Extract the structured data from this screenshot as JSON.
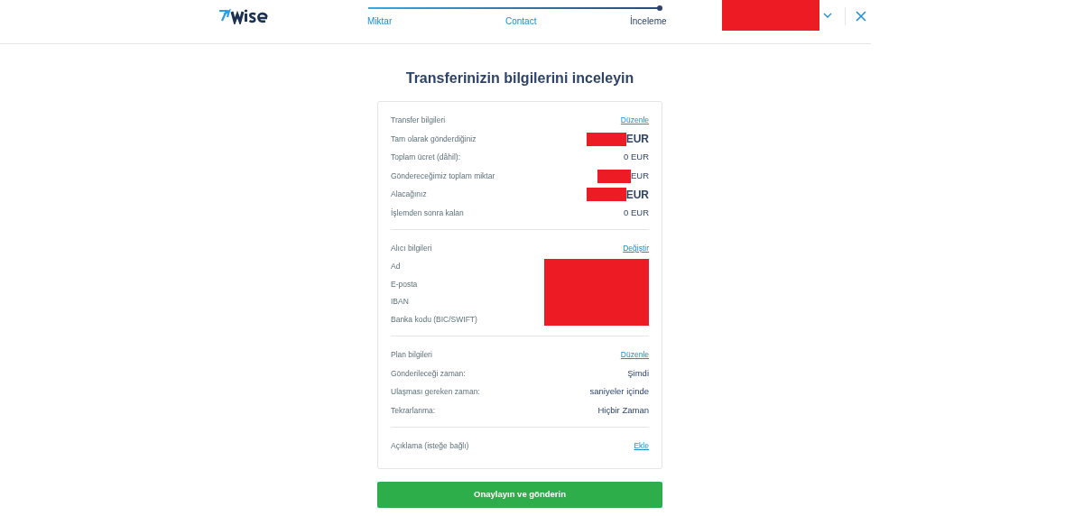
{
  "header": {
    "steps": [
      {
        "label": "Miktar",
        "selected": false
      },
      {
        "label": "Contact",
        "selected": false
      },
      {
        "label": "İnceleme",
        "selected": true
      }
    ],
    "account": {
      "redacted": true
    }
  },
  "title": "Transferinizin bilgilerini inceleyin",
  "sections": [
    {
      "heading": "Transfer bilgileri",
      "action": "Düzenle",
      "rows": [
        {
          "label": "Tam olarak gönderdiğiniz",
          "value": "EUR",
          "redacted": true,
          "emphasis": true
        },
        {
          "label": "Toplam ücret (dâhil):",
          "value": "0 EUR",
          "redacted": false,
          "emphasis": false
        },
        {
          "label": "Göndereceğimiz toplam miktar",
          "value": "EUR",
          "redacted": true,
          "emphasis": false
        },
        {
          "label": "Alacağınız",
          "value": "EUR",
          "redacted": true,
          "emphasis": true
        },
        {
          "label": "İşlemden sonra kalan",
          "value": "0 EUR",
          "redacted": false,
          "emphasis": false
        }
      ]
    },
    {
      "heading": "Alıcı bilgileri",
      "action": "Değiştir",
      "redacted_block": true,
      "rows": [
        {
          "label": "Ad"
        },
        {
          "label": "E-posta"
        },
        {
          "label": "IBAN"
        },
        {
          "label": "Banka kodu (BIC/SWIFT)"
        }
      ]
    },
    {
      "heading": "Plan bilgileri",
      "action": "Düzenle",
      "rows": [
        {
          "label": "Gönderileceği zaman:",
          "value": "Şimdi",
          "redacted": false,
          "emphasis": false
        },
        {
          "label": "Ulaşması gereken zaman:",
          "value": "saniyeler içinde",
          "redacted": false,
          "emphasis": false
        },
        {
          "label": "Tekrarlanma:",
          "value": "Hiçbir Zaman",
          "redacted": false,
          "emphasis": false
        }
      ]
    },
    {
      "heading": "Açıklama (isteğe bağlı)",
      "action": "Ekle"
    }
  ],
  "confirm_button": "Onaylayın ve gönderin"
}
